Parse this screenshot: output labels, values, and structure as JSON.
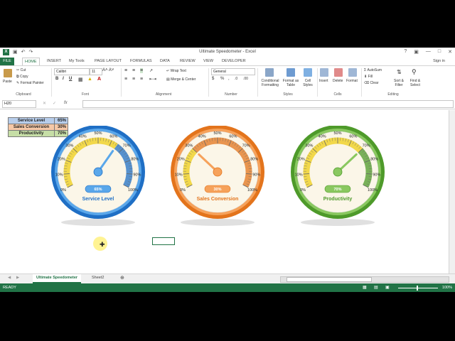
{
  "window": {
    "title": "Ultimate Speedometer - Excel",
    "sign_in": "Sign in"
  },
  "ribbon_tabs": [
    "FILE",
    "HOME",
    "INSERT",
    "My Tools",
    "PAGE LAYOUT",
    "FORMULAS",
    "DATA",
    "REVIEW",
    "VIEW",
    "DEVELOPER"
  ],
  "clipboard": {
    "paste": "Paste",
    "cut": "Cut",
    "copy": "Copy",
    "format_painter": "Format Painter",
    "label": "Clipboard"
  },
  "font": {
    "name": "Calibri",
    "size": "11",
    "label": "Font"
  },
  "alignment": {
    "wrap_text": "Wrap Text",
    "merge_center": "Merge & Center",
    "label": "Alignment"
  },
  "number": {
    "format": "General",
    "label": "Number"
  },
  "styles": {
    "conditional": "Conditional Formatting",
    "format_table": "Format as Table",
    "cell_styles": "Cell Styles",
    "label": "Styles"
  },
  "cells": {
    "insert": "Insert",
    "delete": "Delete",
    "format": "Format",
    "label": "Cells"
  },
  "editing": {
    "autosum": "AutoSum",
    "fill": "Fill",
    "clear": "Clear",
    "sort_filter": "Sort & Filter",
    "find_select": "Find & Select",
    "label": "Editing"
  },
  "formula_bar": {
    "name_box": "H20",
    "fx": "fx",
    "formula": ""
  },
  "table": [
    {
      "label": "Service Level",
      "value": "65%"
    },
    {
      "label": "Sales Conversion",
      "value": "30%"
    },
    {
      "label": "Productivity",
      "value": "70%"
    }
  ],
  "gauges": [
    {
      "name": "Service Level",
      "value": 65,
      "value_label": "65%",
      "color": "#1f6fc5",
      "light": "#5aa7ea"
    },
    {
      "name": "Sales Conversion",
      "value": 30,
      "value_label": "30%",
      "color": "#e3741c",
      "light": "#f6a25b"
    },
    {
      "name": "Productivity",
      "value": 70,
      "value_label": "70%",
      "color": "#4e9a2a",
      "light": "#8ac860"
    }
  ],
  "gauge_ticks": [
    "0%",
    "10%",
    "20%",
    "30%",
    "40%",
    "50%",
    "60%",
    "70%",
    "80%",
    "90%",
    "100%"
  ],
  "sheet_tabs": [
    {
      "label": "Ultimate Speedometer",
      "active": true
    },
    {
      "label": "Sheet2",
      "active": false
    }
  ],
  "status": {
    "ready": "READY",
    "zoom": "100%"
  }
}
